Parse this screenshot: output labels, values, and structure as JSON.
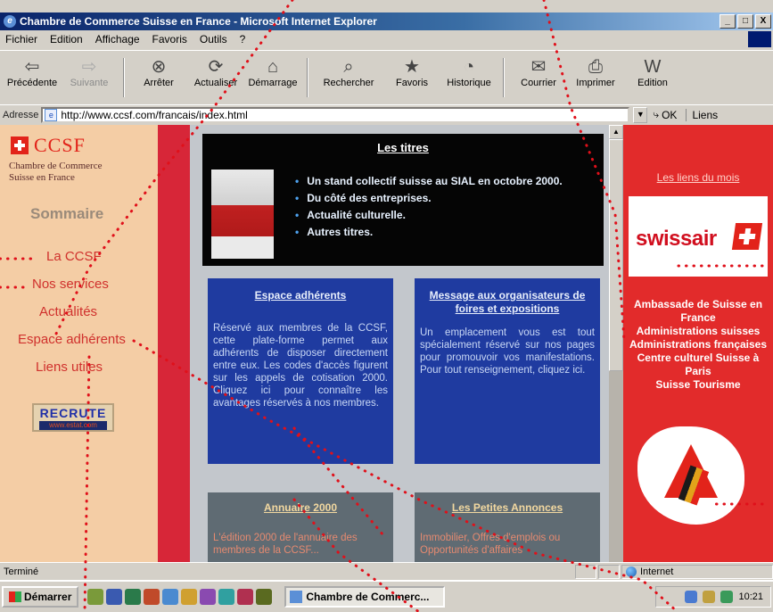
{
  "window": {
    "title": "Chambre de Commerce Suisse en France - Microsoft Internet Explorer",
    "controls": [
      "_",
      "□",
      "X"
    ]
  },
  "menu": [
    "Fichier",
    "Edition",
    "Affichage",
    "Favoris",
    "Outils",
    "?"
  ],
  "toolbar": [
    {
      "label": "Précédente",
      "icon": "back-arrow-icon",
      "glyph": "⇦",
      "enabled": true
    },
    {
      "label": "Suivante",
      "icon": "forward-arrow-icon",
      "glyph": "⇨",
      "enabled": false
    },
    {
      "label": "Arrêter",
      "icon": "stop-icon",
      "glyph": "⊗",
      "enabled": true
    },
    {
      "label": "Actualiser",
      "icon": "refresh-icon",
      "glyph": "⟳",
      "enabled": true
    },
    {
      "label": "Démarrage",
      "icon": "home-icon",
      "glyph": "⌂",
      "enabled": true
    },
    {
      "label": "Rechercher",
      "icon": "search-icon",
      "glyph": "⌕",
      "enabled": true
    },
    {
      "label": "Favoris",
      "icon": "favorites-icon",
      "glyph": "★",
      "enabled": true
    },
    {
      "label": "Historique",
      "icon": "history-icon",
      "glyph": "◔",
      "enabled": true
    },
    {
      "label": "Courrier",
      "icon": "mail-icon",
      "glyph": "✉",
      "enabled": true
    },
    {
      "label": "Imprimer",
      "icon": "print-icon",
      "glyph": "⎙",
      "enabled": true
    },
    {
      "label": "Edition",
      "icon": "edit-icon",
      "glyph": "W",
      "enabled": true
    }
  ],
  "address": {
    "label": "Adresse",
    "url": "http://www.ccsf.com/francais/index.html",
    "go": "OK",
    "links": "Liens"
  },
  "leftnav": {
    "logo": "CCSF",
    "subtitle": "Chambre de Commerce Suisse en France",
    "heading": "Sommaire",
    "links": [
      "La CCSF",
      "Nos services",
      "Actualités",
      "Espace adhérents",
      "Liens utiles"
    ],
    "banner": {
      "big": "RECRUTE",
      "small": "www.estat.com"
    }
  },
  "titres": {
    "heading": "Les titres",
    "items": [
      "Un stand collectif suisse au SIAL en octobre 2000.",
      "Du côté des entreprises.",
      "Actualité culturelle.",
      "Autres titres."
    ]
  },
  "espace": {
    "heading": "Espace adhérents",
    "body": "Réservé aux membres de la CCSF, cette plate-forme permet aux adhérents de disposer directement entre eux. Les codes d'accès figurent sur les appels de cotisation 2000. Cliquez ici pour connaître les avantages réservés à nos membres."
  },
  "message": {
    "heading": "Message aux organisateurs de foires et expositions",
    "body": "Un emplacement vous est tout spécialement réservé sur nos pages pour promouvoir vos manifestations. Pour tout renseignement, cliquez ici."
  },
  "annuaire": {
    "heading": "Annuaire 2000",
    "body": "L'édition 2000 de l'annuaire des membres de la CCSF..."
  },
  "annonces": {
    "heading": "Les Petites Annonces",
    "body": "Immobilier, Offres d'emplois ou Opportunités d'affaires"
  },
  "right": {
    "heading": "Les liens du mois",
    "swissair": "swissair",
    "links": [
      "Ambassade de Suisse en France",
      "Administrations suisses",
      "Administrations françaises",
      "Centre culturel Suisse à Paris",
      "Suisse Tourisme"
    ]
  },
  "status": {
    "text": "Terminé",
    "zone": "Internet"
  },
  "taskbar": {
    "start": "Démarrer",
    "task": "Chambre de Commerc...",
    "clock": "10:21"
  },
  "colors": {
    "accent_red": "#e22b2b",
    "nav_bg": "#f4cda5",
    "box_blue": "#1f3ba0",
    "titlebar": "#0a246a"
  }
}
